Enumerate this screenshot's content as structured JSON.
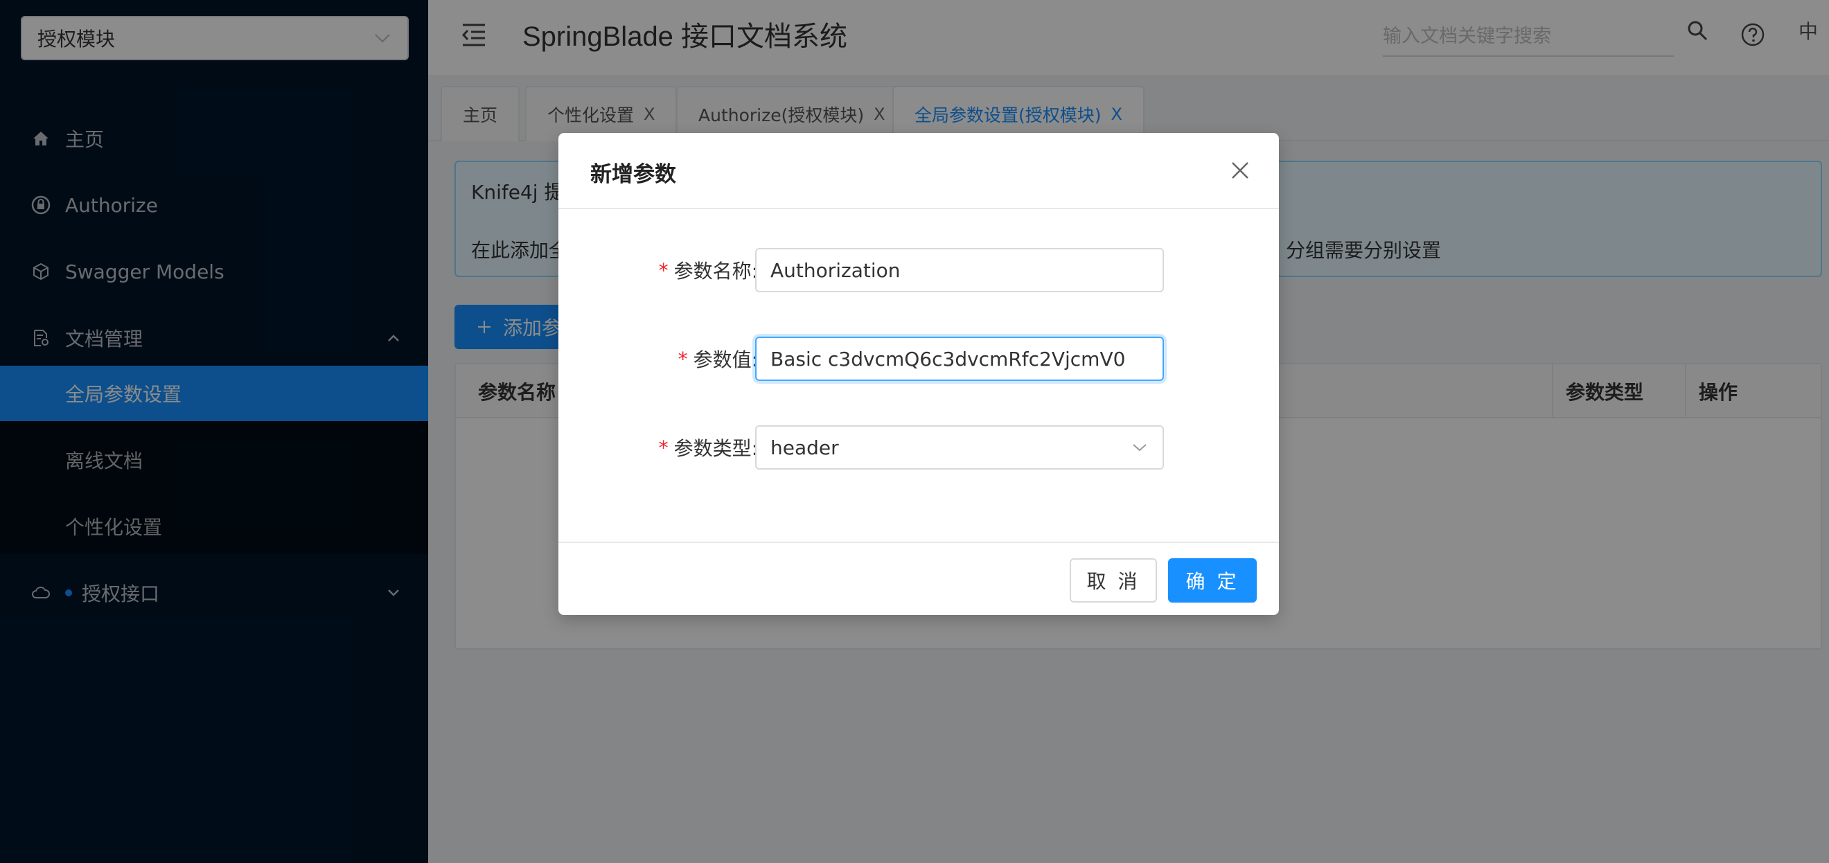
{
  "sidebar": {
    "module_select": "授权模块",
    "items": [
      {
        "label": "主页",
        "icon": "home-icon"
      },
      {
        "label": "Authorize",
        "icon": "lock-icon"
      },
      {
        "label": "Swagger Models",
        "icon": "cube-icon"
      },
      {
        "label": "文档管理",
        "icon": "document-settings-icon",
        "expanded": true,
        "children": [
          {
            "label": "全局参数设置",
            "active": true
          },
          {
            "label": "离线文档"
          },
          {
            "label": "个性化设置"
          }
        ]
      },
      {
        "label": "授权接口",
        "icon": "cloud-icon",
        "expanded": false
      }
    ]
  },
  "header": {
    "title": "SpringBlade 接口文档系统",
    "search_placeholder": "输入文档关键字搜索",
    "lang": "中"
  },
  "tabs": [
    {
      "label": "主页",
      "closable": false
    },
    {
      "label": "个性化设置",
      "closable": true
    },
    {
      "label": "Authorize(授权模块)",
      "closable": true
    },
    {
      "label": "全局参数设置(授权模块)",
      "closable": true,
      "active": true
    }
  ],
  "tab_close_glyph": "X",
  "content": {
    "alert_line1": "Knife4j 提",
    "alert_line2": "在此添加全",
    "alert_line2_tail": "分组需要分别设置",
    "add_button": "添加参",
    "table_headers": {
      "name": "参数名称",
      "type": "参数类型",
      "ops": "操作"
    }
  },
  "modal": {
    "title": "新增参数",
    "fields": {
      "name": {
        "label": "参数名称:",
        "value": "Authorization"
      },
      "value": {
        "label": "参数值:",
        "value": "Basic c3dvcmQ6c3dvcmRfc2VjcmV0"
      },
      "type": {
        "label": "参数类型:",
        "value": "header"
      }
    },
    "required_mark": "*",
    "cancel": "取 消",
    "ok": "确 定"
  },
  "colors": {
    "primary": "#1890ff",
    "sidebar_bg": "#001529",
    "required": "#f5222d"
  }
}
